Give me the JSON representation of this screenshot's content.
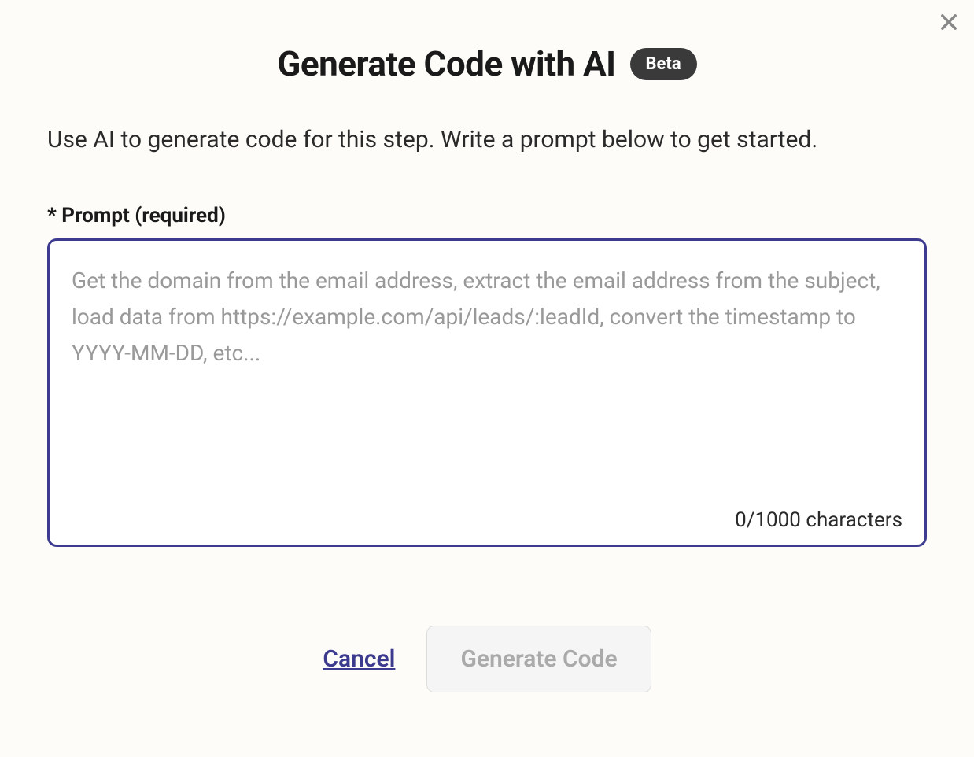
{
  "dialog": {
    "title": "Generate Code with AI",
    "badge": "Beta",
    "description": "Use AI to generate code for this step. Write a prompt below to get started.",
    "prompt_label": "* Prompt (required)",
    "prompt_placeholder": "Get the domain from the email address, extract the email address from the subject, load data from https://example.com/api/leads/:leadId, convert the timestamp to YYYY-MM-DD, etc...",
    "char_counter": "0/1000 characters",
    "cancel_label": "Cancel",
    "generate_label": "Generate Code"
  }
}
